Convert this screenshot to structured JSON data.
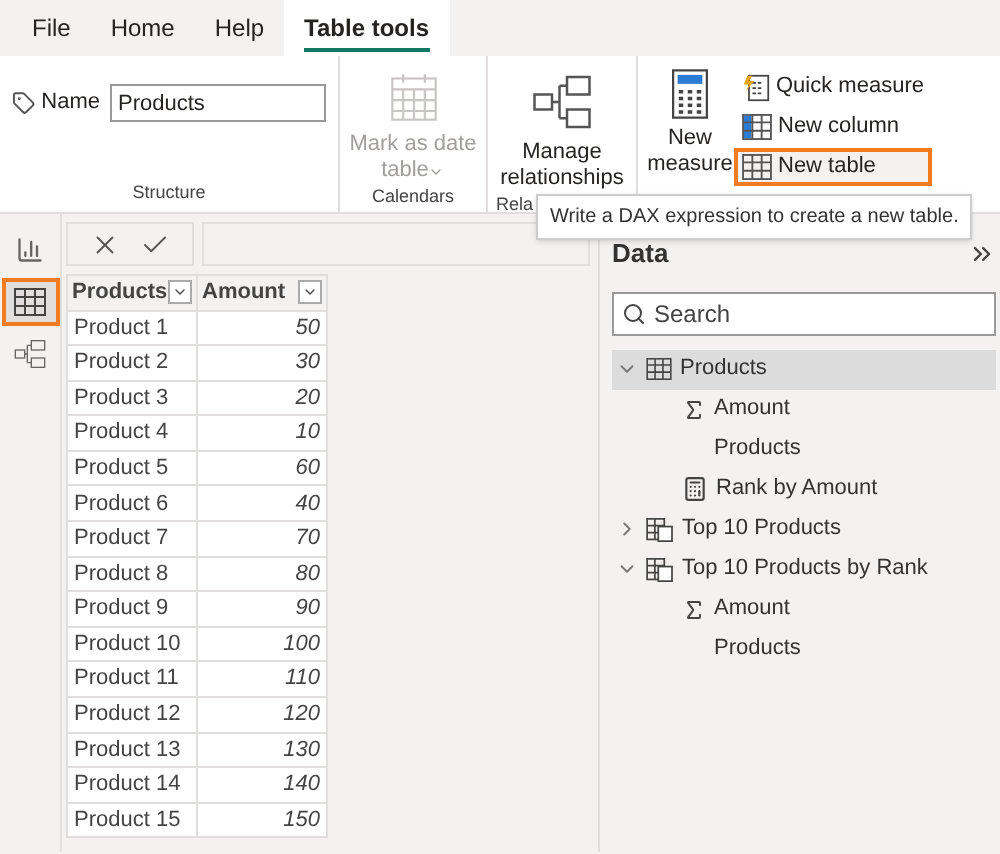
{
  "tabs": [
    {
      "label": "File",
      "selected": false
    },
    {
      "label": "Home",
      "selected": false
    },
    {
      "label": "Help",
      "selected": false
    },
    {
      "label": "Table tools",
      "selected": true
    }
  ],
  "ribbon": {
    "structure": {
      "name_label": "Name",
      "name_value": "Products",
      "group_label": "Structure"
    },
    "calendars": {
      "button_lines": [
        "Mark as date",
        "table"
      ],
      "disabled": true,
      "group_label": "Calendars"
    },
    "relationships": {
      "button_lines": [
        "Manage",
        "relationships"
      ],
      "group_label": "Rela"
    },
    "calculations": {
      "big_button_lines": [
        "New",
        "measure"
      ],
      "buttons": [
        {
          "kind": "quick",
          "label": "Quick measure",
          "highlighted": false
        },
        {
          "kind": "column",
          "label": "New column",
          "highlighted": false
        },
        {
          "kind": "table",
          "label": "New table",
          "highlighted": true
        }
      ]
    }
  },
  "tooltip": "Write a DAX expression to create a new table.",
  "views": [
    {
      "kind": "report",
      "selected": false
    },
    {
      "kind": "table",
      "selected": true
    },
    {
      "kind": "model",
      "selected": false
    }
  ],
  "table": {
    "columns": [
      "Products",
      "Amount"
    ],
    "rows": [
      [
        "Product 1",
        "50"
      ],
      [
        "Product 2",
        "30"
      ],
      [
        "Product 3",
        "20"
      ],
      [
        "Product 4",
        "10"
      ],
      [
        "Product 5",
        "60"
      ],
      [
        "Product 6",
        "40"
      ],
      [
        "Product 7",
        "70"
      ],
      [
        "Product 8",
        "80"
      ],
      [
        "Product 9",
        "90"
      ],
      [
        "Product 10",
        "100"
      ],
      [
        "Product 11",
        "110"
      ],
      [
        "Product 12",
        "120"
      ],
      [
        "Product 13",
        "130"
      ],
      [
        "Product 14",
        "140"
      ],
      [
        "Product 15",
        "150"
      ]
    ]
  },
  "data_pane": {
    "title": "Data",
    "search_placeholder": "Search",
    "tree": [
      {
        "kind": "table",
        "label": "Products",
        "expanded": true,
        "selected": true,
        "children": [
          {
            "kind": "sum",
            "label": "Amount"
          },
          {
            "kind": "column",
            "label": "Products"
          },
          {
            "kind": "measure",
            "label": "Rank by Amount"
          }
        ]
      },
      {
        "kind": "calc_table",
        "label": "Top 10 Products",
        "expanded": false,
        "selected": false
      },
      {
        "kind": "calc_table",
        "label": "Top 10 Products by Rank",
        "expanded": true,
        "selected": false,
        "children": [
          {
            "kind": "sum",
            "label": "Amount"
          },
          {
            "kind": "column",
            "label": "Products"
          }
        ]
      }
    ]
  }
}
